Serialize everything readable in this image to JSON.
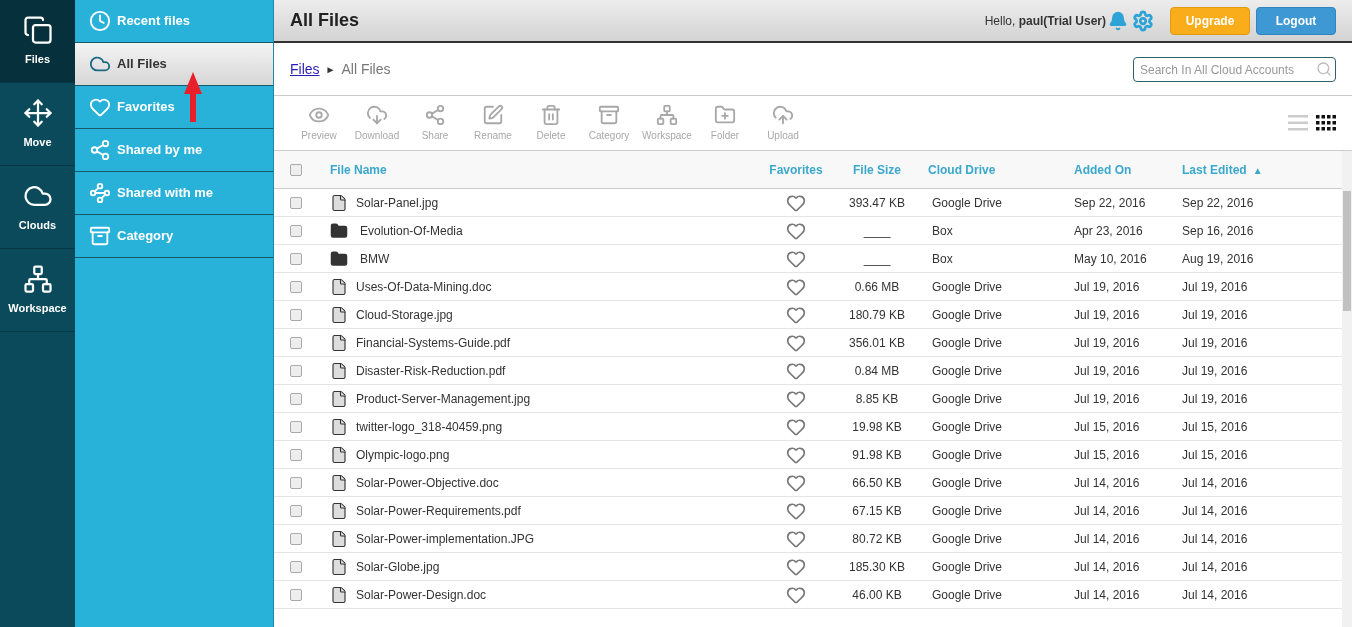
{
  "rail": [
    {
      "kind": "files",
      "label": "Files",
      "selected": true
    },
    {
      "kind": "move",
      "label": "Move",
      "selected": false
    },
    {
      "kind": "clouds",
      "label": "Clouds",
      "selected": false
    },
    {
      "kind": "workspace",
      "label": "Workspace",
      "selected": false
    }
  ],
  "nav": [
    {
      "kind": "recent",
      "label": "Recent files",
      "selected": false
    },
    {
      "kind": "all",
      "label": "All Files",
      "selected": true
    },
    {
      "kind": "favorites",
      "label": "Favorites",
      "selected": false
    },
    {
      "kind": "shared_by",
      "label": "Shared by me",
      "selected": false
    },
    {
      "kind": "shared_with",
      "label": "Shared with me",
      "selected": false
    },
    {
      "kind": "category",
      "label": "Category",
      "selected": false
    }
  ],
  "header": {
    "title": "All Files",
    "greeting": "Hello, **paul(Trial User)**",
    "buttons": [
      {
        "kind": "upgrade",
        "label": "Upgrade"
      },
      {
        "kind": "logout",
        "label": "Logout"
      }
    ]
  },
  "breadcrumb": {
    "link": "Files",
    "separator": "►",
    "current": "All Files"
  },
  "search": {
    "placeholder": "Search In All Cloud Accounts"
  },
  "toolbar": [
    {
      "kind": "preview",
      "label": "Preview",
      "disabled": true
    },
    {
      "kind": "download",
      "label": "Download",
      "disabled": true
    },
    {
      "kind": "share",
      "label": "Share",
      "disabled": true
    },
    {
      "kind": "rename",
      "label": "Rename",
      "disabled": true
    },
    {
      "kind": "delete",
      "label": "Delete",
      "disabled": true
    },
    {
      "kind": "category",
      "label": "Category",
      "disabled": true
    },
    {
      "kind": "workspace",
      "label": "Workspace",
      "disabled": true
    },
    {
      "kind": "folder",
      "label": "Folder",
      "disabled": true
    },
    {
      "kind": "upload",
      "label": "Upload",
      "disabled": true
    }
  ],
  "views": [
    {
      "kind": "list",
      "selected": false
    },
    {
      "kind": "grid",
      "selected": true
    }
  ],
  "table": {
    "all_checked": false,
    "columns": [
      {
        "label": "File Name"
      },
      {
        "label": "Favorites"
      },
      {
        "label": "File Size"
      },
      {
        "label": "Cloud Drive"
      },
      {
        "label": "Added On"
      },
      {
        "label": "Last Edited",
        "sort_indicator": "▲"
      }
    ],
    "rows": [
      {
        "kind": "file",
        "checked": false,
        "favorite": false,
        "name": "Solar-Panel.jpg",
        "size": "393.47 KB",
        "drive": "Google Drive",
        "added": "Sep 22, 2016",
        "edited": "Sep 22, 2016"
      },
      {
        "kind": "folder",
        "checked": false,
        "favorite": false,
        "name": "Evolution-Of-Media",
        "size": "____",
        "drive": "Box",
        "added": "Apr 23, 2016",
        "edited": "Sep 16, 2016"
      },
      {
        "kind": "folder",
        "checked": false,
        "favorite": false,
        "name": "BMW",
        "size": "____",
        "drive": "Box",
        "added": "May 10, 2016",
        "edited": "Aug 19, 2016"
      },
      {
        "kind": "file",
        "checked": false,
        "favorite": false,
        "name": "Uses-Of-Data-Mining.doc",
        "size": "0.66 MB",
        "drive": "Google Drive",
        "added": "Jul 19, 2016",
        "edited": "Jul 19, 2016"
      },
      {
        "kind": "file",
        "checked": false,
        "favorite": false,
        "name": "Cloud-Storage.jpg",
        "size": "180.79 KB",
        "drive": "Google Drive",
        "added": "Jul 19, 2016",
        "edited": "Jul 19, 2016"
      },
      {
        "kind": "file",
        "checked": false,
        "favorite": false,
        "name": "Financial-Systems-Guide.pdf",
        "size": "356.01 KB",
        "drive": "Google Drive",
        "added": "Jul 19, 2016",
        "edited": "Jul 19, 2016"
      },
      {
        "kind": "file",
        "checked": false,
        "favorite": false,
        "name": "Disaster-Risk-Reduction.pdf",
        "size": "0.84 MB",
        "drive": "Google Drive",
        "added": "Jul 19, 2016",
        "edited": "Jul 19, 2016"
      },
      {
        "kind": "file",
        "checked": false,
        "favorite": false,
        "name": "Product-Server-Management.jpg",
        "size": "8.85 KB",
        "drive": "Google Drive",
        "added": "Jul 19, 2016",
        "edited": "Jul 19, 2016"
      },
      {
        "kind": "file",
        "checked": false,
        "favorite": false,
        "name": "twitter-logo_318-40459.png",
        "size": "19.98 KB",
        "drive": "Google Drive",
        "added": "Jul 15, 2016",
        "edited": "Jul 15, 2016"
      },
      {
        "kind": "file",
        "checked": false,
        "favorite": false,
        "name": "Olympic-logo.png",
        "size": "91.98 KB",
        "drive": "Google Drive",
        "added": "Jul 15, 2016",
        "edited": "Jul 15, 2016"
      },
      {
        "kind": "file",
        "checked": false,
        "favorite": false,
        "name": "Solar-Power-Objective.doc",
        "size": "66.50 KB",
        "drive": "Google Drive",
        "added": "Jul 14, 2016",
        "edited": "Jul 14, 2016"
      },
      {
        "kind": "file",
        "checked": false,
        "favorite": false,
        "name": "Solar-Power-Requirements.pdf",
        "size": "67.15 KB",
        "drive": "Google Drive",
        "added": "Jul 14, 2016",
        "edited": "Jul 14, 2016"
      },
      {
        "kind": "file",
        "checked": false,
        "favorite": false,
        "name": "Solar-Power-implementation.JPG",
        "size": "80.72 KB",
        "drive": "Google Drive",
        "added": "Jul 14, 2016",
        "edited": "Jul 14, 2016"
      },
      {
        "kind": "file",
        "checked": false,
        "favorite": false,
        "name": "Solar-Globe.jpg",
        "size": "185.30 KB",
        "drive": "Google Drive",
        "added": "Jul 14, 2016",
        "edited": "Jul 14, 2016"
      },
      {
        "kind": "file",
        "checked": false,
        "favorite": false,
        "name": "Solar-Power-Design.doc",
        "size": "46.00 KB",
        "drive": "Google Drive",
        "added": "Jul 14, 2016",
        "edited": "Jul 14, 2016"
      }
    ]
  }
}
